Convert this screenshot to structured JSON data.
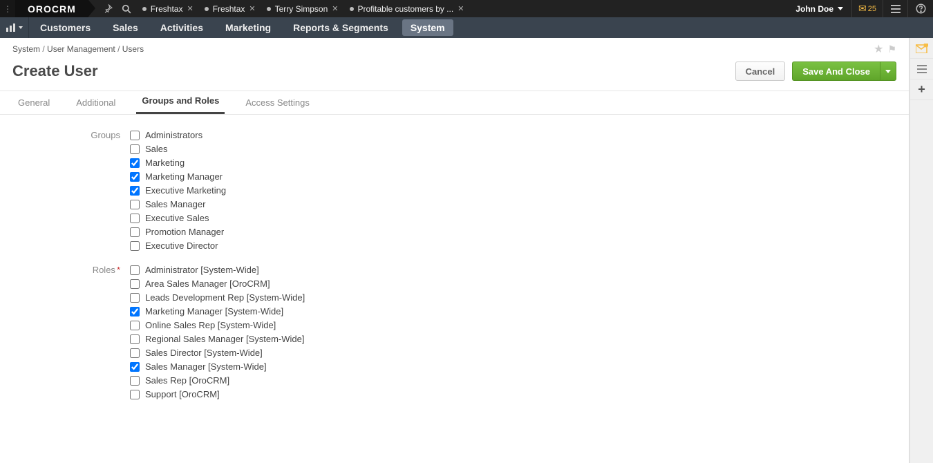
{
  "brand": "OROCRM",
  "notifications": "25",
  "user_name": "John Doe",
  "tabs_open": [
    {
      "label": "Freshtax"
    },
    {
      "label": "Freshtax"
    },
    {
      "label": "Terry Simpson"
    },
    {
      "label": "Profitable customers by ..."
    }
  ],
  "main_menu": {
    "items": [
      "Customers",
      "Sales",
      "Activities",
      "Marketing",
      "Reports & Segments",
      "System"
    ],
    "active_index": 5
  },
  "breadcrumb": [
    "System",
    "User Management",
    "Users"
  ],
  "page_title": "Create User",
  "buttons": {
    "cancel": "Cancel",
    "save": "Save And Close"
  },
  "page_tabs": {
    "items": [
      "General",
      "Additional",
      "Groups and Roles",
      "Access Settings"
    ],
    "active_index": 2
  },
  "form": {
    "groups_label": "Groups",
    "roles_label": "Roles",
    "roles_required": true,
    "groups": [
      {
        "label": "Administrators",
        "checked": false
      },
      {
        "label": "Sales",
        "checked": false
      },
      {
        "label": "Marketing",
        "checked": true
      },
      {
        "label": "Marketing Manager",
        "checked": true
      },
      {
        "label": "Executive Marketing",
        "checked": true
      },
      {
        "label": "Sales Manager",
        "checked": false
      },
      {
        "label": "Executive Sales",
        "checked": false
      },
      {
        "label": "Promotion Manager",
        "checked": false
      },
      {
        "label": "Executive Director",
        "checked": false
      }
    ],
    "roles": [
      {
        "label": "Administrator [System-Wide]",
        "checked": false
      },
      {
        "label": "Area Sales Manager [OroCRM]",
        "checked": false
      },
      {
        "label": "Leads Development Rep [System-Wide]",
        "checked": false
      },
      {
        "label": "Marketing Manager [System-Wide]",
        "checked": true
      },
      {
        "label": "Online Sales Rep [System-Wide]",
        "checked": false
      },
      {
        "label": "Regional Sales Manager [System-Wide]",
        "checked": false
      },
      {
        "label": "Sales Director [System-Wide]",
        "checked": false
      },
      {
        "label": "Sales Manager [System-Wide]",
        "checked": true
      },
      {
        "label": "Sales Rep [OroCRM]",
        "checked": false
      },
      {
        "label": "Support [OroCRM]",
        "checked": false
      }
    ]
  }
}
